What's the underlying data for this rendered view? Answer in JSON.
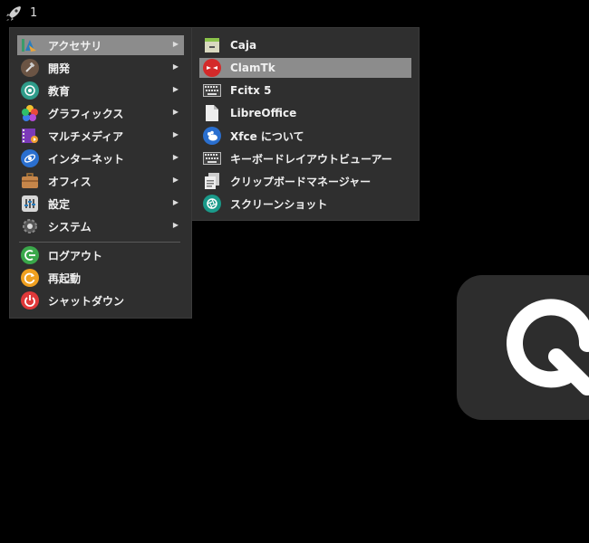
{
  "panel": {
    "workspace_number": "1"
  },
  "main_menu": {
    "categories": [
      {
        "label": "アクセサリ",
        "icon": "accessories-icon"
      },
      {
        "label": "開発",
        "icon": "development-icon"
      },
      {
        "label": "教育",
        "icon": "education-icon"
      },
      {
        "label": "グラフィックス",
        "icon": "graphics-icon"
      },
      {
        "label": "マルチメディア",
        "icon": "multimedia-icon"
      },
      {
        "label": "インターネット",
        "icon": "internet-icon"
      },
      {
        "label": "オフィス",
        "icon": "office-icon"
      },
      {
        "label": "設定",
        "icon": "settings-icon"
      },
      {
        "label": "システム",
        "icon": "system-icon"
      }
    ],
    "actions": [
      {
        "label": "ログアウト",
        "icon": "logout-icon"
      },
      {
        "label": "再起動",
        "icon": "restart-icon"
      },
      {
        "label": "シャットダウン",
        "icon": "shutdown-icon"
      }
    ],
    "highlighted": "アクセサリ"
  },
  "accessories_submenu": {
    "items": [
      {
        "label": "Caja",
        "icon": "file-manager-icon"
      },
      {
        "label": "ClamTk",
        "icon": "antivirus-icon"
      },
      {
        "label": "Fcitx 5",
        "icon": "keyboard-icon"
      },
      {
        "label": "LibreOffice",
        "icon": "document-icon"
      },
      {
        "label": "Xfce について",
        "icon": "xfce-mouse-icon"
      },
      {
        "label": "キーボードレイアウトビューアー",
        "icon": "keyboard-layout-icon"
      },
      {
        "label": "クリップボードマネージャー",
        "icon": "clipboard-icon"
      },
      {
        "label": "スクリーンショット",
        "icon": "screenshot-icon"
      }
    ],
    "highlighted": "ClamTk"
  },
  "colors": {
    "menu_bg": "#2f2f2f",
    "highlight": "#8c8c8c",
    "widget_bg": "#2d2d2d"
  }
}
